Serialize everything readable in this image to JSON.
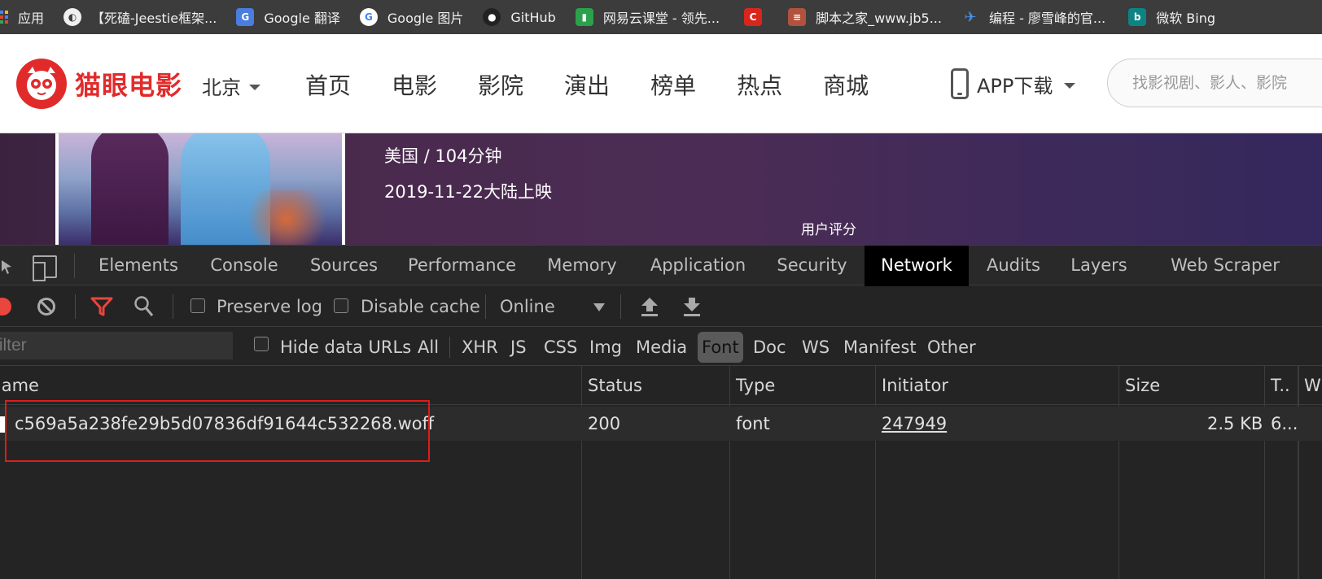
{
  "bookmarks": [
    {
      "label": "应用",
      "icon": "apps-grid-icon"
    },
    {
      "label": "",
      "icon": "globe-icon"
    },
    {
      "label": "【死磕-Jeestie框架...",
      "icon": "page-icon"
    },
    {
      "label": "Google 翻译",
      "icon": "google-translate-icon"
    },
    {
      "label": "Google 图片",
      "icon": "google-icon"
    },
    {
      "label": "GitHub",
      "icon": "github-icon"
    },
    {
      "label": "网易云课堂 - 领先...",
      "icon": "netease-icon"
    },
    {
      "label": "",
      "icon": "csdn-icon"
    },
    {
      "label": "脚本之家_www.jb5...",
      "icon": "jb51-icon"
    },
    {
      "label": "编程 - 廖雪峰的官...",
      "icon": "rocket-icon"
    },
    {
      "label": "微软 Bing",
      "icon": "bing-icon"
    }
  ],
  "site": {
    "logo_text": "猫眼电影",
    "city": "北京",
    "nav": [
      "首页",
      "电影",
      "影院",
      "演出",
      "榜单",
      "热点",
      "商城"
    ],
    "app_download": "APP下载",
    "search_placeholder": "找影视剧、影人、影院"
  },
  "movie": {
    "country_duration": "美国 / 104分钟",
    "release": "2019-11-22大陆上映",
    "rating_label": "用户评分"
  },
  "devtools": {
    "tabs": [
      "Elements",
      "Console",
      "Sources",
      "Performance",
      "Memory",
      "Application",
      "Security",
      "Network",
      "Audits",
      "Layers",
      "Web Scraper"
    ],
    "active_tab": "Network",
    "toolbar": {
      "preserve_log": "Preserve log",
      "disable_cache": "Disable cache",
      "throttle": "Online"
    },
    "filter": {
      "placeholder": "Filter",
      "hide_data_urls": "Hide data URLs",
      "types": [
        "All",
        "XHR",
        "JS",
        "CSS",
        "Img",
        "Media",
        "Font",
        "Doc",
        "WS",
        "Manifest",
        "Other"
      ],
      "active_type": "Font"
    },
    "columns": [
      "Name",
      "Status",
      "Type",
      "Initiator",
      "Size",
      "T..",
      "W"
    ],
    "rows": [
      {
        "name": "c569a5a238fe29b5d07836df91644c532268.woff",
        "status": "200",
        "type": "font",
        "initiator": "247949",
        "size": "2.5 KB",
        "time": "6..."
      }
    ]
  },
  "colors": {
    "brand_red": "#e12b2b",
    "devtools_bg": "#242424",
    "highlight": "#e01b1b"
  }
}
